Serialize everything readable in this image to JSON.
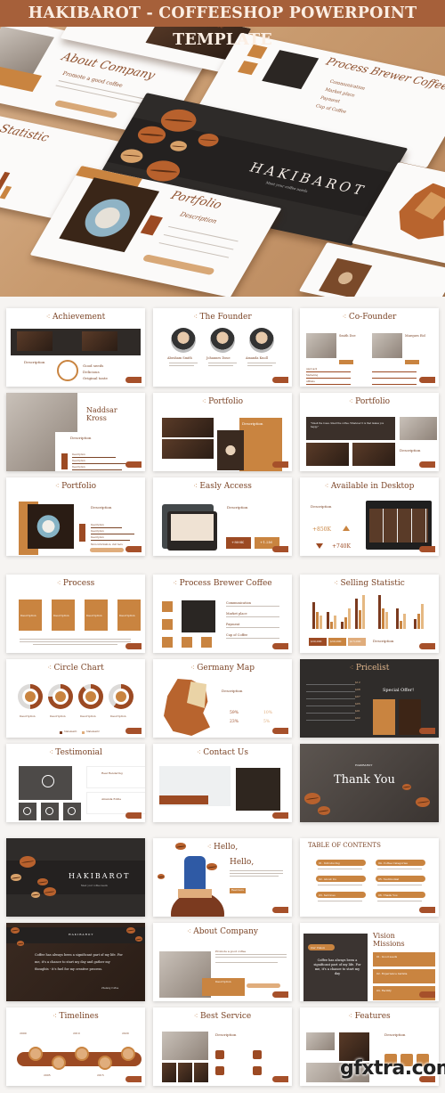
{
  "banner": {
    "title": "HAKIBAROT - COFFEESHOP POWERPOINT TEMPLATE"
  },
  "hero": {
    "mockups": [
      {
        "title": "About Company",
        "subtitle": "Promote a good coffee"
      },
      {
        "title": "Process Brewer Coffee",
        "items": [
          "Communication",
          "Market place",
          "Payment",
          "Cup of Coffee"
        ]
      },
      {
        "title": "HAKIBAROT",
        "subtitle": "Meet your coffee needs"
      },
      {
        "title": "Portfolio",
        "subtitle": "Description"
      },
      {
        "title": "Statistic"
      },
      {
        "title": "Achievement"
      }
    ]
  },
  "colors": {
    "brand_brown": "#a6603a",
    "accent_orange": "#c98440",
    "deep_brown": "#9c4a23",
    "title_text": "#7b4426"
  },
  "slides": [
    {
      "title": "Achievement",
      "items": [
        "Good seeds",
        "Delicious",
        "Original taste"
      ],
      "desc": "Description"
    },
    {
      "title": "The Founder",
      "people": [
        "Abraham Smith",
        "Johannes Doue",
        "Amanda Knoll"
      ]
    },
    {
      "title": "Co-Founder",
      "people": [
        "Smith Doe",
        "Marques Eid"
      ],
      "skills": [
        "Approach",
        "Marketing",
        "Affiliate"
      ]
    },
    {
      "title": "Naddsar Kross",
      "desc": "Description",
      "bars": [
        {
          "label": "Description",
          "value": 0.7
        },
        {
          "label": "Description",
          "value": 0.9
        },
        {
          "label": "Description",
          "value": 0.8
        }
      ]
    },
    {
      "title": "Portfolio",
      "desc": "Description"
    },
    {
      "title": "Portfolio",
      "quote": "\"Smell the roses. Smell the coffee. Whatever it is that makes you happy.\"",
      "desc": "Description"
    },
    {
      "title": "Portfolio",
      "desc": "Description",
      "bars": [
        {
          "label": "Description",
          "value": 0.6
        },
        {
          "label": "Description",
          "value": 0.85
        },
        {
          "label": "Description",
          "value": 0.75
        }
      ],
      "more": "More information, visit here"
    },
    {
      "title": "Easly Access",
      "desc": "Description",
      "stats": [
        "+800K",
        "+1.2M"
      ]
    },
    {
      "title": "Available in Desktop",
      "desc": "Description",
      "stats": [
        "+850K",
        "+740K"
      ]
    },
    {
      "title": "Process",
      "steps": [
        "Description",
        "Description",
        "Description",
        "Description"
      ]
    },
    {
      "title": "Process Brewer Coffee",
      "items": [
        "Communication",
        "Market place",
        "Payment",
        "Cup of Coffee"
      ]
    },
    {
      "title": "Selling Statistic",
      "totals": [
        "$30,000",
        "$30,000",
        "$15,000"
      ],
      "desc": "Description"
    },
    {
      "title": "Circle Chart",
      "items": [
        "Description",
        "Description",
        "Description",
        "Description"
      ],
      "legend": [
        "Statement1",
        "Statement2"
      ],
      "values": [
        0.5,
        0.75,
        0.9,
        0.6
      ]
    },
    {
      "title": "Germany Map",
      "desc": "Description",
      "stats": [
        {
          "value": "59%",
          "label": "Performance"
        },
        {
          "value": "10%",
          "label": "Good Analysis"
        },
        {
          "value": "23%",
          "label": "Experience"
        },
        {
          "value": "5%",
          "label": "Market"
        }
      ]
    },
    {
      "title": "Pricelist",
      "offer": "Special Offer!",
      "prices": [
        "$12",
        "$08",
        "$07",
        "$05",
        "$01",
        "$02"
      ]
    },
    {
      "title": "Testimonial",
      "people": [
        "Real Rendering",
        "Amanda Eddie"
      ]
    },
    {
      "title": "Contact Us"
    },
    {
      "title": "Thank You",
      "brand": "HAKIBAROT"
    },
    {
      "title": "HAKIBAROT",
      "subtitle": "Meet your coffee needs"
    },
    {
      "title": "Hello,",
      "button": "Read more"
    },
    {
      "title": "TABLE OF CONTENTS",
      "items": [
        "01. Introducing",
        "04. Coffee Categories",
        "02. About Us",
        "05. Testimonial",
        "03. Services",
        "06. Thank You"
      ]
    },
    {
      "title": "HAKIBAROT",
      "quote": "Coffee has always been a significant part of my life. For me, it's a chance to start my day and gather my thoughts - it's fuel for my creative process.",
      "author": "Zhelang Coffee"
    },
    {
      "title": "About Company",
      "subtitle": "Promote a good coffee",
      "desc": "Description"
    },
    {
      "title": "Vision Missions",
      "tag": "Our Vision",
      "quote": "Coffee has always been a significant part of my life. For me, it's a chance to start my day",
      "items": [
        "01. Good seeds",
        "02. Experience barista",
        "03. Facility"
      ]
    },
    {
      "title": "Timelines",
      "years": [
        "2000",
        "2010",
        "2020",
        "2005",
        "2015"
      ]
    },
    {
      "title": "Best Service",
      "desc": "Description"
    },
    {
      "title": "Features",
      "desc": "Description"
    }
  ],
  "watermark": "gfxtra.com"
}
